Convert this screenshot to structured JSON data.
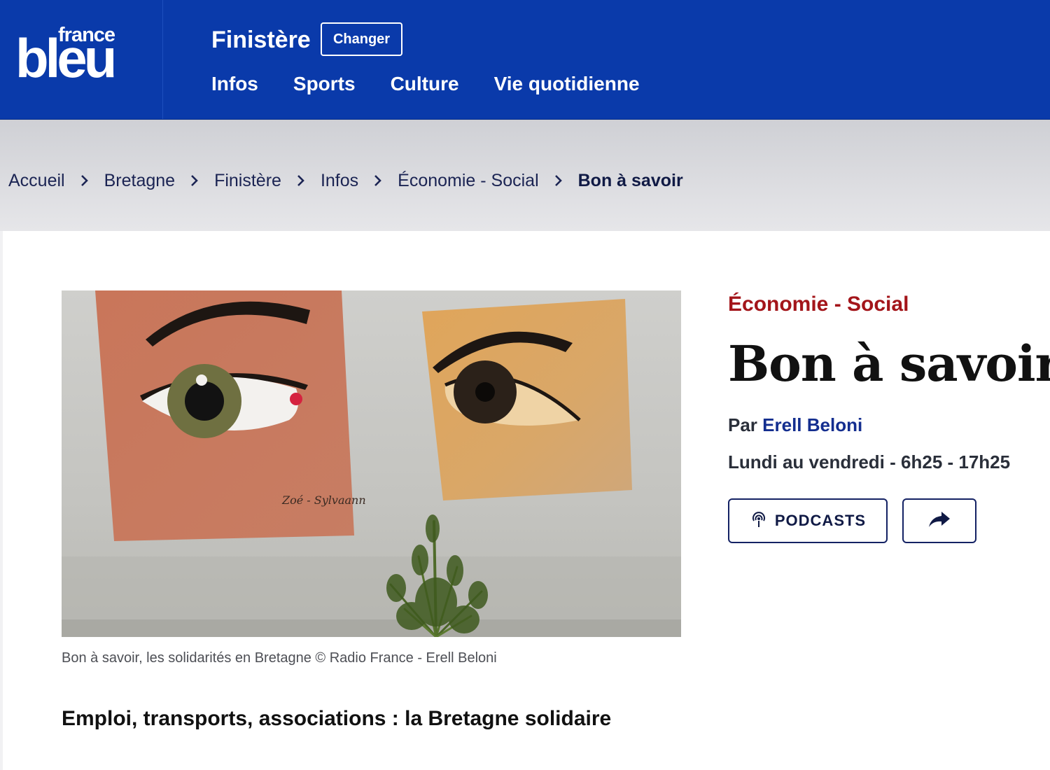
{
  "header": {
    "logo_top": "france",
    "logo_main": "bleu",
    "station": "Finistère",
    "change_label": "Changer",
    "nav": [
      {
        "label": "Infos"
      },
      {
        "label": "Sports"
      },
      {
        "label": "Culture"
      },
      {
        "label": "Vie quotidienne"
      }
    ]
  },
  "breadcrumb": [
    {
      "label": "Accueil"
    },
    {
      "label": "Bretagne"
    },
    {
      "label": "Finistère"
    },
    {
      "label": "Infos"
    },
    {
      "label": "Économie - Social"
    },
    {
      "label": "Bon à savoir"
    }
  ],
  "hero": {
    "caption": "Bon à savoir, les solidarités en Bretagne © Radio France - Erell Beloni",
    "signature": "Zoé - Sylvaann"
  },
  "article": {
    "subtitle": "Emploi, transports, associations : la Bretagne solidaire"
  },
  "sidebar": {
    "category": "Économie - Social",
    "title": "Bon à savoir",
    "by_prefix": "Par",
    "author": "Erell Beloni",
    "schedule": "Lundi au vendredi - 6h25 - 17h25",
    "podcasts_label": "PODCASTS",
    "podcast_icon": "podcast-icon",
    "share_icon": "share-arrow-icon"
  },
  "colors": {
    "header_bg": "#0a3aaa",
    "category_red": "#a3151a",
    "button_border": "#142264",
    "author_blue": "#142e8f"
  }
}
